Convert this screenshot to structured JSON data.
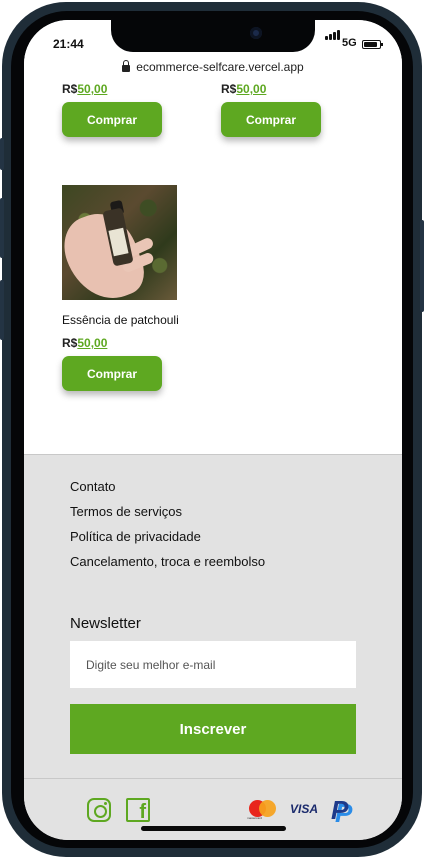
{
  "statusbar": {
    "time": "21:44",
    "network": "5G",
    "url": "ecommerce-selfcare.vercel.app"
  },
  "products": [
    {
      "currency": "R$",
      "price": "50,00",
      "button": "Comprar"
    },
    {
      "currency": "R$",
      "price": "50,00",
      "button": "Comprar"
    },
    {
      "name": "Essência de patchouli",
      "currency": "R$",
      "price": "50,00",
      "button": "Comprar"
    }
  ],
  "footer": {
    "links": [
      "Contato",
      "Termos de serviços",
      "Política de privacidade",
      "Cancelamento, troca e reembolso"
    ],
    "newsletter_title": "Newsletter",
    "email_placeholder": "Digite seu melhor e-mail",
    "subscribe_label": "Inscrever",
    "facebook_glyph": "f",
    "mastercard_text": "mastercard",
    "visa_text": "VISA",
    "paypal_glyph": "P"
  },
  "icons": [
    "lock-icon",
    "instagram-icon",
    "facebook-icon",
    "mastercard-icon",
    "visa-icon",
    "paypal-icon"
  ],
  "colors": {
    "accent": "#5ea821",
    "footer_bg": "#e2e2e2"
  }
}
